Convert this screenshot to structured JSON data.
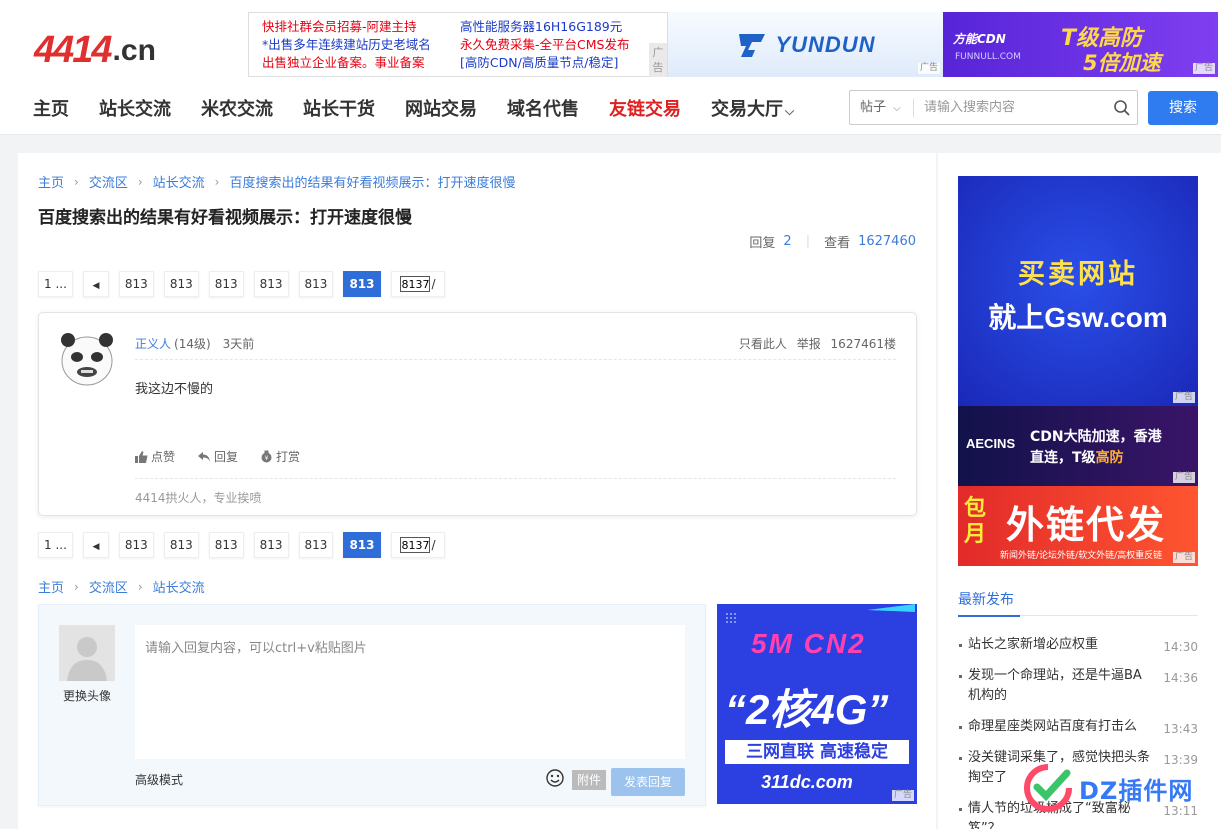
{
  "logo": {
    "big": "4414",
    "domain": ".cn"
  },
  "ads": {
    "text_ad": {
      "col1": [
        "快排社群会员招募-阿建主持",
        "*出售多年连续建站历史老域名",
        "出售独立企业备案。事业备案"
      ],
      "col2": [
        "高性能服务器16H16G189元",
        "永久免费采集-全平台CMS发布",
        "[高防CDN/高质量节点/稳定]"
      ],
      "tag": "广告"
    },
    "yundun": {
      "text": "YUNDUN",
      "tag": "广告"
    },
    "funnull": {
      "name": "方能CDN",
      "sub": "FUNNULL.COM",
      "t1": "T级高防",
      "t2": "5倍加速",
      "tag": "广告"
    },
    "gsw": {
      "line1": "买卖网站",
      "line2": "就上Gsw.com",
      "tag": "广告"
    },
    "aecins": {
      "brand": "AECINS",
      "line1": "CDN大陆加速，香港",
      "line2a": "直连，T级",
      "line2b": "高防",
      "tag": "广告"
    },
    "waillian": {
      "left": "包月",
      "main": "外链代发",
      "sub": "新闻外链/论坛外链/软文外链/高权重反链",
      "tag": "广告"
    },
    "dc311": {
      "l1": "5M CN2",
      "l2": "“2核4G”",
      "l3": "三网直联 高速稳定",
      "l4": "311dc.com",
      "tag": "广告"
    }
  },
  "nav": {
    "items": [
      "主页",
      "站长交流",
      "米农交流",
      "站长干货",
      "网站交易",
      "域名代售",
      "友链交易",
      "交易大厅"
    ],
    "chev": "⌵"
  },
  "search": {
    "select": "帖子",
    "placeholder": "请输入搜索内容",
    "button": "搜索"
  },
  "breadcrumb": [
    "主页",
    "交流区",
    "站长交流",
    "百度搜索出的结果有好看视频展示：打开速度很慢"
  ],
  "breadcrumb_bottom": [
    "主页",
    "交流区",
    "站长交流"
  ],
  "thread": {
    "title": "百度搜索出的结果有好看视频展示：打开速度很慢",
    "reply_label": "回复",
    "reply_count": "2",
    "view_label": "查看",
    "view_count": "1627460"
  },
  "pager": {
    "first": "1 ...",
    "prev": "◀",
    "pages": [
      "813",
      "813",
      "813",
      "813",
      "813"
    ],
    "current": "813",
    "input_value": "8137",
    "slash": "/"
  },
  "post": {
    "username": "正义人",
    "level": "(14级)",
    "time": "3天前",
    "only_author": "只看此人",
    "report": "举报",
    "floor": "1627461楼",
    "content": "我这边不慢的",
    "like": "点赞",
    "reply": "回复",
    "reward": "打赏",
    "signature": "4414拱火人，专业挨喷"
  },
  "reply_box": {
    "change_avatar": "更换头像",
    "placeholder": "请输入回复内容，可以ctrl+v粘贴图片",
    "advanced": "高级模式",
    "attach": "附件",
    "submit": "发表回复"
  },
  "sidebar": {
    "title": "最新发布",
    "items": [
      {
        "title": "站长之家新增必应权重",
        "time": "14:30"
      },
      {
        "title": "发现一个命理站，还是牛逼BA机构的",
        "time": "14:36"
      },
      {
        "title": "命理星座类网站百度有打击么",
        "time": "13:43"
      },
      {
        "title": "没关键词采集了，感觉快把头条掏空了",
        "time": "13:39"
      },
      {
        "title": "情人节的垃圾桶成了“致富秘笈”？",
        "time": "13:11"
      }
    ]
  },
  "watermark": {
    "text": "DZ插件网"
  },
  "colors": {
    "accent": "#2f7bf0",
    "link": "#3b7cd9",
    "red": "#e02020",
    "logo_red": "#e02f2f"
  }
}
